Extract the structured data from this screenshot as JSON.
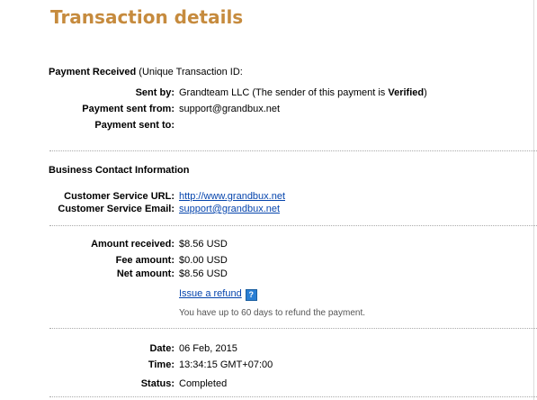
{
  "title": "Transaction details",
  "payment": {
    "received_label": "Payment Received",
    "received_suffix": "(Unique Transaction ID:",
    "sent_by_label": "Sent by:",
    "sent_by_value_prefix": "Grandteam LLC (The sender of this payment is ",
    "sent_by_verified": "Verified",
    "sent_by_value_suffix": ")",
    "sent_from_label": "Payment sent from:",
    "sent_from_value": "support@grandbux.net",
    "sent_to_label": "Payment sent to:",
    "sent_to_value": ""
  },
  "business": {
    "heading": "Business Contact Information",
    "url_label": "Customer Service URL:",
    "url_value": "http://www.grandbux.net",
    "email_label": "Customer Service Email:",
    "email_value": "support@grandbux.net"
  },
  "amounts": {
    "received_label": "Amount received:",
    "received_value": "$8.56 USD",
    "fee_label": "Fee amount:",
    "fee_value": "$0.00 USD",
    "net_label": "Net amount:",
    "net_value": "$8.56 USD",
    "refund_link": "Issue a refund",
    "help_icon": "question-help-icon",
    "refund_note": "You have up to 60 days to refund the payment."
  },
  "details": {
    "date_label": "Date:",
    "date_value": "06 Feb, 2015",
    "time_label": "Time:",
    "time_value": "13:34:15 GMT+07:00",
    "status_label": "Status:",
    "status_value": "Completed"
  },
  "colors": {
    "title": "#c68b3e",
    "link": "#0645ad",
    "help_icon": "#2a7fd4"
  }
}
